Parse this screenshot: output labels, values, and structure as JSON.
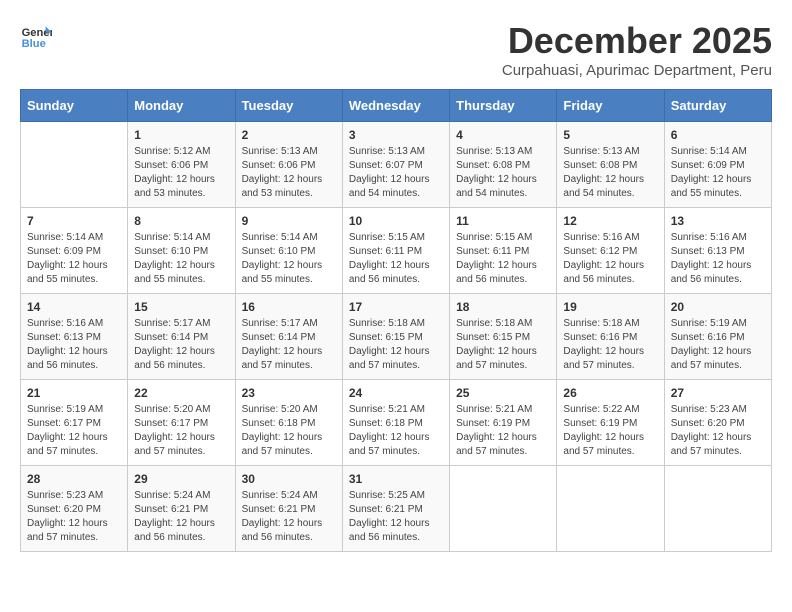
{
  "logo": {
    "general": "General",
    "blue": "Blue"
  },
  "title": "December 2025",
  "subtitle": "Curpahuasi, Apurimac Department, Peru",
  "weekdays": [
    "Sunday",
    "Monday",
    "Tuesday",
    "Wednesday",
    "Thursday",
    "Friday",
    "Saturday"
  ],
  "weeks": [
    [
      {
        "day": "",
        "info": ""
      },
      {
        "day": "1",
        "info": "Sunrise: 5:12 AM\nSunset: 6:06 PM\nDaylight: 12 hours\nand 53 minutes."
      },
      {
        "day": "2",
        "info": "Sunrise: 5:13 AM\nSunset: 6:06 PM\nDaylight: 12 hours\nand 53 minutes."
      },
      {
        "day": "3",
        "info": "Sunrise: 5:13 AM\nSunset: 6:07 PM\nDaylight: 12 hours\nand 54 minutes."
      },
      {
        "day": "4",
        "info": "Sunrise: 5:13 AM\nSunset: 6:08 PM\nDaylight: 12 hours\nand 54 minutes."
      },
      {
        "day": "5",
        "info": "Sunrise: 5:13 AM\nSunset: 6:08 PM\nDaylight: 12 hours\nand 54 minutes."
      },
      {
        "day": "6",
        "info": "Sunrise: 5:14 AM\nSunset: 6:09 PM\nDaylight: 12 hours\nand 55 minutes."
      }
    ],
    [
      {
        "day": "7",
        "info": "Sunrise: 5:14 AM\nSunset: 6:09 PM\nDaylight: 12 hours\nand 55 minutes."
      },
      {
        "day": "8",
        "info": "Sunrise: 5:14 AM\nSunset: 6:10 PM\nDaylight: 12 hours\nand 55 minutes."
      },
      {
        "day": "9",
        "info": "Sunrise: 5:14 AM\nSunset: 6:10 PM\nDaylight: 12 hours\nand 55 minutes."
      },
      {
        "day": "10",
        "info": "Sunrise: 5:15 AM\nSunset: 6:11 PM\nDaylight: 12 hours\nand 56 minutes."
      },
      {
        "day": "11",
        "info": "Sunrise: 5:15 AM\nSunset: 6:11 PM\nDaylight: 12 hours\nand 56 minutes."
      },
      {
        "day": "12",
        "info": "Sunrise: 5:16 AM\nSunset: 6:12 PM\nDaylight: 12 hours\nand 56 minutes."
      },
      {
        "day": "13",
        "info": "Sunrise: 5:16 AM\nSunset: 6:13 PM\nDaylight: 12 hours\nand 56 minutes."
      }
    ],
    [
      {
        "day": "14",
        "info": "Sunrise: 5:16 AM\nSunset: 6:13 PM\nDaylight: 12 hours\nand 56 minutes."
      },
      {
        "day": "15",
        "info": "Sunrise: 5:17 AM\nSunset: 6:14 PM\nDaylight: 12 hours\nand 56 minutes."
      },
      {
        "day": "16",
        "info": "Sunrise: 5:17 AM\nSunset: 6:14 PM\nDaylight: 12 hours\nand 57 minutes."
      },
      {
        "day": "17",
        "info": "Sunrise: 5:18 AM\nSunset: 6:15 PM\nDaylight: 12 hours\nand 57 minutes."
      },
      {
        "day": "18",
        "info": "Sunrise: 5:18 AM\nSunset: 6:15 PM\nDaylight: 12 hours\nand 57 minutes."
      },
      {
        "day": "19",
        "info": "Sunrise: 5:18 AM\nSunset: 6:16 PM\nDaylight: 12 hours\nand 57 minutes."
      },
      {
        "day": "20",
        "info": "Sunrise: 5:19 AM\nSunset: 6:16 PM\nDaylight: 12 hours\nand 57 minutes."
      }
    ],
    [
      {
        "day": "21",
        "info": "Sunrise: 5:19 AM\nSunset: 6:17 PM\nDaylight: 12 hours\nand 57 minutes."
      },
      {
        "day": "22",
        "info": "Sunrise: 5:20 AM\nSunset: 6:17 PM\nDaylight: 12 hours\nand 57 minutes."
      },
      {
        "day": "23",
        "info": "Sunrise: 5:20 AM\nSunset: 6:18 PM\nDaylight: 12 hours\nand 57 minutes."
      },
      {
        "day": "24",
        "info": "Sunrise: 5:21 AM\nSunset: 6:18 PM\nDaylight: 12 hours\nand 57 minutes."
      },
      {
        "day": "25",
        "info": "Sunrise: 5:21 AM\nSunset: 6:19 PM\nDaylight: 12 hours\nand 57 minutes."
      },
      {
        "day": "26",
        "info": "Sunrise: 5:22 AM\nSunset: 6:19 PM\nDaylight: 12 hours\nand 57 minutes."
      },
      {
        "day": "27",
        "info": "Sunrise: 5:23 AM\nSunset: 6:20 PM\nDaylight: 12 hours\nand 57 minutes."
      }
    ],
    [
      {
        "day": "28",
        "info": "Sunrise: 5:23 AM\nSunset: 6:20 PM\nDaylight: 12 hours\nand 57 minutes."
      },
      {
        "day": "29",
        "info": "Sunrise: 5:24 AM\nSunset: 6:21 PM\nDaylight: 12 hours\nand 56 minutes."
      },
      {
        "day": "30",
        "info": "Sunrise: 5:24 AM\nSunset: 6:21 PM\nDaylight: 12 hours\nand 56 minutes."
      },
      {
        "day": "31",
        "info": "Sunrise: 5:25 AM\nSunset: 6:21 PM\nDaylight: 12 hours\nand 56 minutes."
      },
      {
        "day": "",
        "info": ""
      },
      {
        "day": "",
        "info": ""
      },
      {
        "day": "",
        "info": ""
      }
    ]
  ]
}
